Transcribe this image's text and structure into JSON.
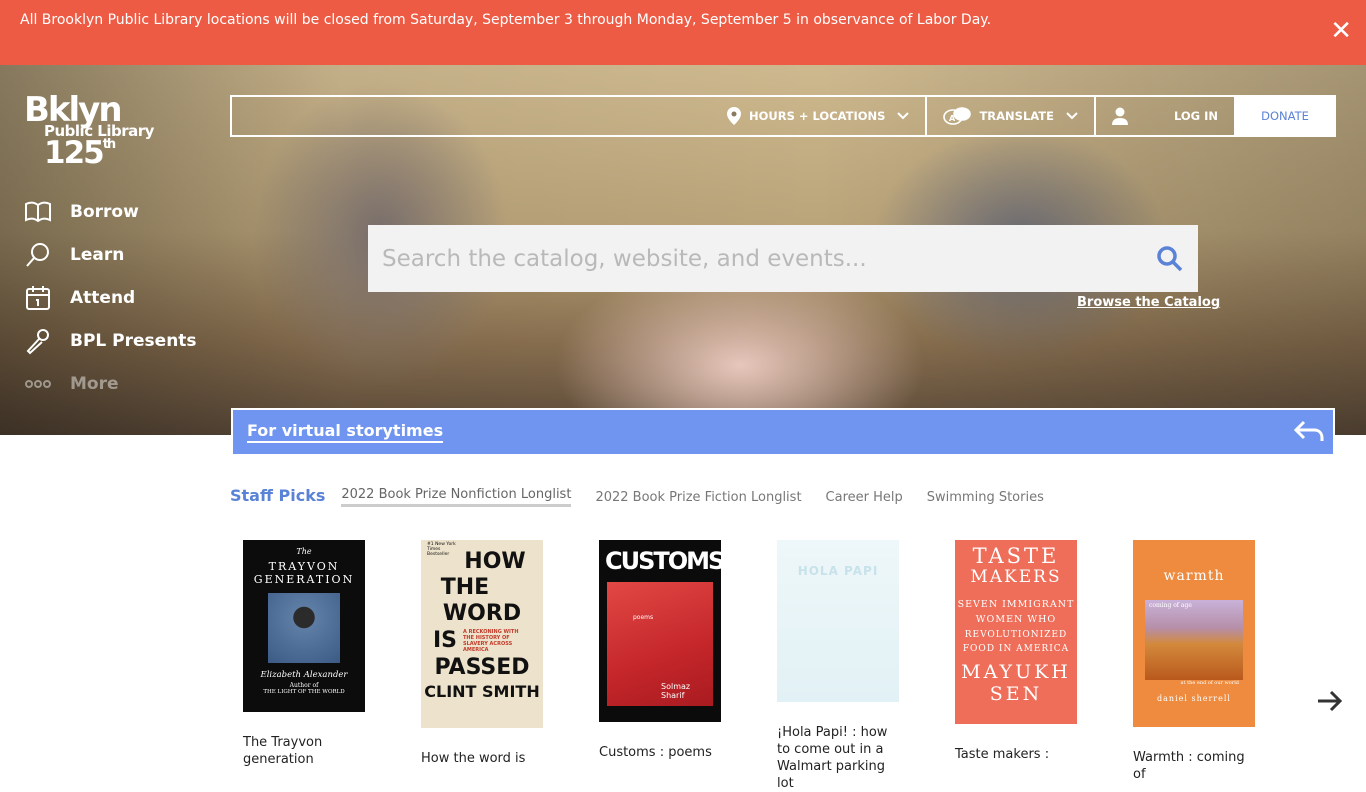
{
  "alert": {
    "message": "All Brooklyn Public Library locations will be closed from Saturday, September 3 through Monday, September 5 in observance of Labor Day.",
    "close_icon": "close-icon",
    "color": "#ee5b44"
  },
  "logo": {
    "line1": "Bklyn",
    "line2": "Public Library",
    "line3": "125",
    "sup": "th"
  },
  "nav": {
    "borrow": "Borrow",
    "learn": "Learn",
    "attend": "Attend",
    "presents": "BPL Presents",
    "more": "More"
  },
  "topbar": {
    "hours": "HOURS + LOCATIONS",
    "translate": "TRANSLATE",
    "login": "LOG IN",
    "donate": "DONATE"
  },
  "search": {
    "placeholder": "Search the catalog, website, and events...",
    "browse_link": "Browse the Catalog"
  },
  "banner": {
    "text": "For virtual storytimes",
    "color": "#6f95f1"
  },
  "tabs": {
    "label": "Staff Picks",
    "items": [
      "2022 Book Prize Nonfiction Longlist",
      "2022 Book Prize Fiction Longlist",
      "Career Help",
      "Swimming Stories"
    ],
    "active": "2022 Book Prize Nonfiction Longlist"
  },
  "books": [
    {
      "title": "The Trayvon generation",
      "cover_lines": [
        "The",
        "TRAYVON",
        "GENERATION",
        "Elizabeth Alexander",
        "Author of",
        "THE LIGHT OF THE WORLD"
      ]
    },
    {
      "title": "How the word is",
      "cover_lines": [
        "#1 New York Times Bestseller",
        "HOW",
        "THE",
        "WORD",
        "IS",
        "PASSED",
        "A RECKONING WITH THE HISTORY OF SLAVERY ACROSS AMERICA",
        "CLINT SMITH"
      ]
    },
    {
      "title": "Customs : poems",
      "cover_lines": [
        "CUSTOMS",
        "poems",
        "Solmaz Sharif"
      ]
    },
    {
      "title": "¡Hola Papi! : how to come out in a Walmart parking lot",
      "cover_lines": [
        "HOLA PAPI"
      ]
    },
    {
      "title": "Taste makers :",
      "cover_lines": [
        "TASTE",
        "MAKERS",
        "SEVEN IMMIGRANT",
        "WOMEN WHO",
        "REVOLUTIONIZED",
        "FOOD IN AMERICA",
        "MAYUKH",
        "SEN"
      ]
    },
    {
      "title": "Warmth : coming of",
      "cover_lines": [
        "warmth",
        "coming of age",
        "at the end of our world",
        "daniel sherrell"
      ]
    }
  ]
}
